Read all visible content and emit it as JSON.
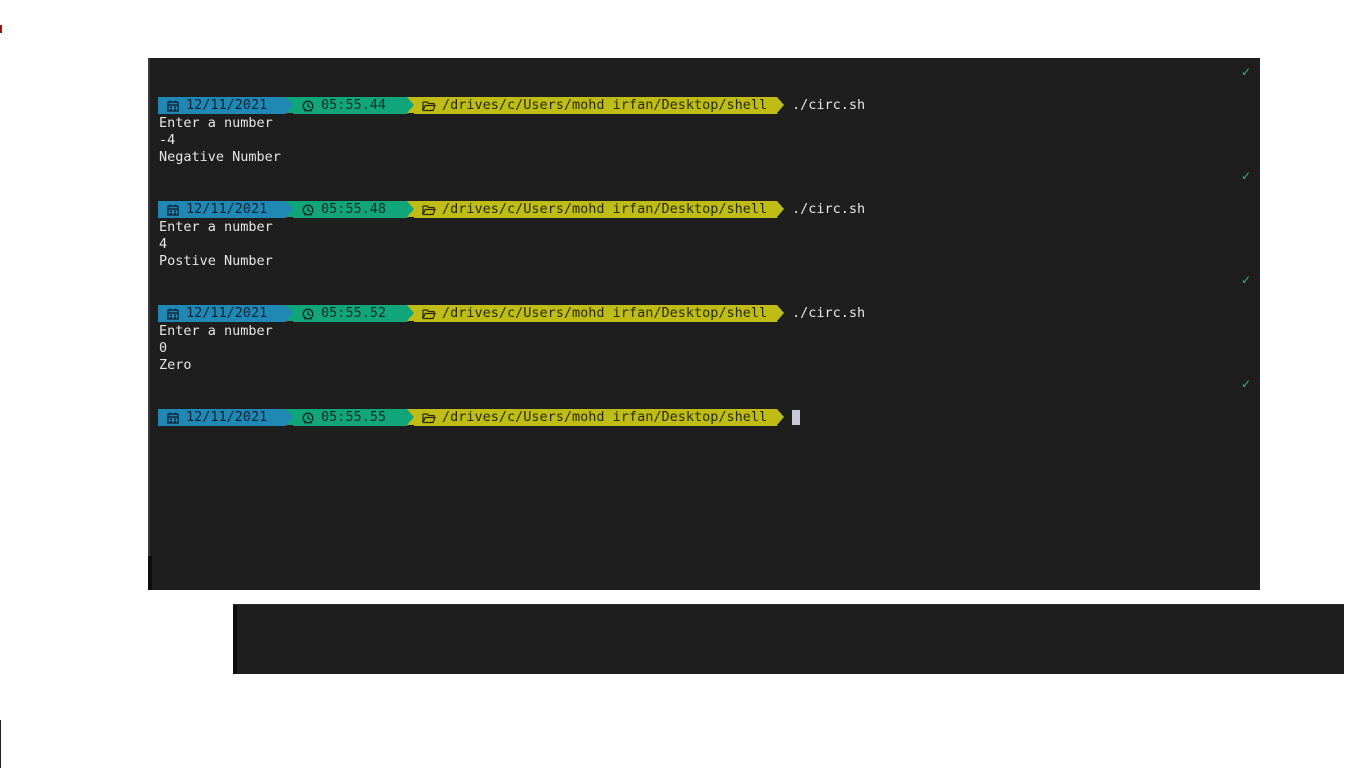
{
  "colors": {
    "terminal_bg": "#1e1e1e",
    "date_segment": "#1f88b5",
    "time_segment": "#11a57a",
    "path_segment": "#bfbd15",
    "check": "#28c840",
    "text": "#e6e6e6"
  },
  "status_icon": "✓",
  "icons": {
    "date": "calendar-icon",
    "time": "clock-icon",
    "path": "folder-icon"
  },
  "sessions": [
    {
      "date": "12/11/2021",
      "time": "05:55.44",
      "path": "/drives/c/Users/mohd irfan/Desktop/shell",
      "command": "./circ.sh",
      "output": [
        "Enter a number",
        "-4",
        "Negative Number"
      ]
    },
    {
      "date": "12/11/2021",
      "time": "05:55.48",
      "path": "/drives/c/Users/mohd irfan/Desktop/shell",
      "command": "./circ.sh",
      "output": [
        "Enter a number",
        "4",
        "Postive Number"
      ]
    },
    {
      "date": "12/11/2021",
      "time": "05:55.52",
      "path": "/drives/c/Users/mohd irfan/Desktop/shell",
      "command": "./circ.sh",
      "output": [
        "Enter a number",
        "0",
        "Zero"
      ]
    },
    {
      "date": "12/11/2021",
      "time": "05:55.55",
      "path": "/drives/c/Users/mohd irfan/Desktop/shell",
      "command": ""
    }
  ]
}
